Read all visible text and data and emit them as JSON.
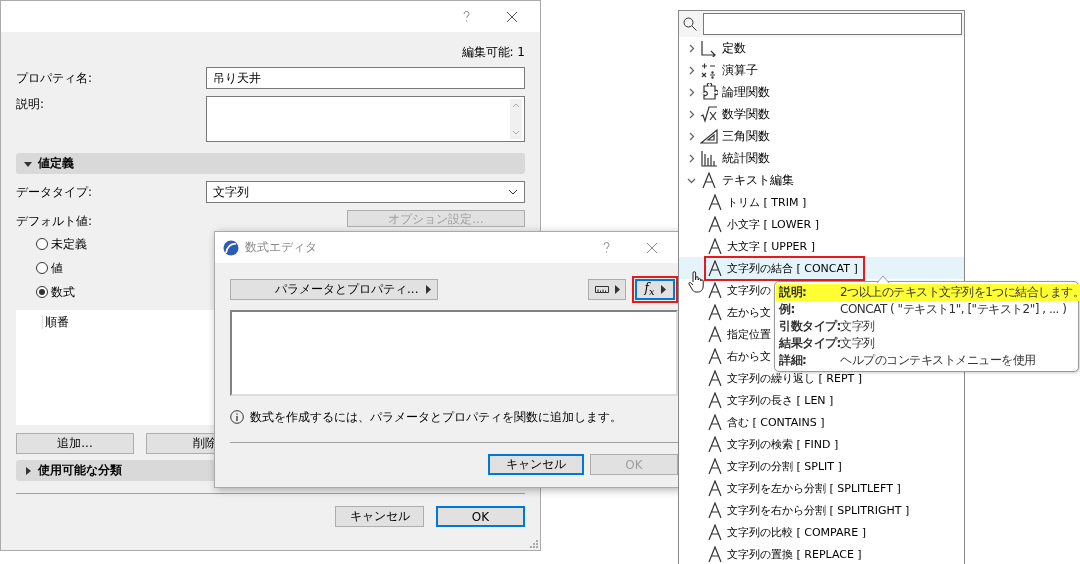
{
  "property_dialog": {
    "edit_count": "編集可能: 1",
    "name_field": {
      "label": "プロパティ名:",
      "value": "吊り天井"
    },
    "description_field": {
      "label": "説明:"
    },
    "value_section": {
      "title": "値定義",
      "expanded": true
    },
    "data_type": {
      "label": "データタイプ:",
      "value": "文字列"
    },
    "default_value": {
      "label": "デフォルト値:",
      "options_button": {
        "label": "オプション設定...",
        "disabled": true
      }
    },
    "radios": [
      {
        "label": "未定義",
        "selected": false
      },
      {
        "label": "値",
        "selected": false
      },
      {
        "label": "数式",
        "selected": true
      }
    ],
    "list_items": [
      "順番"
    ],
    "list_buttons": [
      "追加...",
      "削除"
    ],
    "classification_section": {
      "title": "使用可能な分類",
      "expanded": false
    },
    "buttons": [
      {
        "label": "キャンセル",
        "default": false
      },
      {
        "label": "OK",
        "default": true
      }
    ]
  },
  "formula_editor": {
    "title": "数式エディタ",
    "params_button": "パラメータとプロパティ...",
    "function_button": {
      "label": "f$_{x}$",
      "highlighted": true
    },
    "info": "数式を作成するには、パラメータとプロパティを関数に追加します。",
    "buttons": [
      {
        "label": "キャンセル",
        "default": true,
        "disabled": false
      },
      {
        "label": "OK",
        "default": false,
        "disabled": true
      }
    ]
  },
  "function_panel": {
    "tree": [
      {
        "label": "定数",
        "kind": "constant",
        "expanded": false,
        "selected": false
      },
      {
        "label": "演算子",
        "kind": "operator",
        "expanded": false,
        "selected": false
      },
      {
        "label": "論理関数",
        "kind": "logic",
        "expanded": false,
        "selected": false
      },
      {
        "label": "数学関数",
        "kind": "math",
        "expanded": false,
        "selected": false
      },
      {
        "label": "三角関数",
        "kind": "trig",
        "expanded": false,
        "selected": false
      },
      {
        "label": "統計関数",
        "kind": "stats",
        "expanded": false,
        "selected": false
      },
      {
        "label": "テキスト編集",
        "kind": "text",
        "expanded": true,
        "selected": false,
        "children": [
          {
            "label": "トリム [ TRIM ]",
            "selected": false
          },
          {
            "label": "小文字 [ LOWER ]",
            "selected": false
          },
          {
            "label": "大文字 [ UPPER ]",
            "selected": false
          },
          {
            "label": "文字列の結合 [ CONCAT ]",
            "selected": true
          },
          {
            "label": "文字列の",
            "selected": false
          },
          {
            "label": "左から文",
            "selected": false
          },
          {
            "label": "指定位置",
            "selected": false
          },
          {
            "label": "右から文",
            "selected": false
          },
          {
            "label": "文字列の繰り返し [ REPT ]",
            "selected": false
          },
          {
            "label": "文字列の長さ [ LEN ]",
            "selected": false
          },
          {
            "label": "含む [ CONTAINS ]",
            "selected": false
          },
          {
            "label": "文字列の検索 [ FIND ]",
            "selected": false
          },
          {
            "label": "文字列の分割 [ SPLIT ]",
            "selected": false
          },
          {
            "label": "文字列を左から分割 [ SPLITLEFT ]",
            "selected": false
          },
          {
            "label": "文字列を右から分割 [ SPLITRIGHT ]",
            "selected": false
          },
          {
            "label": "文字列の比較 [ COMPARE ]",
            "selected": false
          },
          {
            "label": "文字列の置換 [ REPLACE ]",
            "selected": false
          }
        ]
      }
    ],
    "tooltip": {
      "rows": [
        {
          "label": "説明:",
          "value": "2つ以上のテキスト文字列を1つに結合します。",
          "highlighted": true
        },
        {
          "label": "例:",
          "value": "CONCAT ( \"テキスト1\", [\"テキスト2\"] , ... )",
          "highlighted": false
        },
        {
          "label": "引数タイプ:",
          "value": "文字列",
          "highlighted": false
        },
        {
          "label": "結果タイプ:",
          "value": "文字列",
          "highlighted": false
        },
        {
          "label": "詳細:",
          "value": "ヘルプのコンテキストメニューを使用",
          "highlighted": false
        }
      ]
    }
  }
}
